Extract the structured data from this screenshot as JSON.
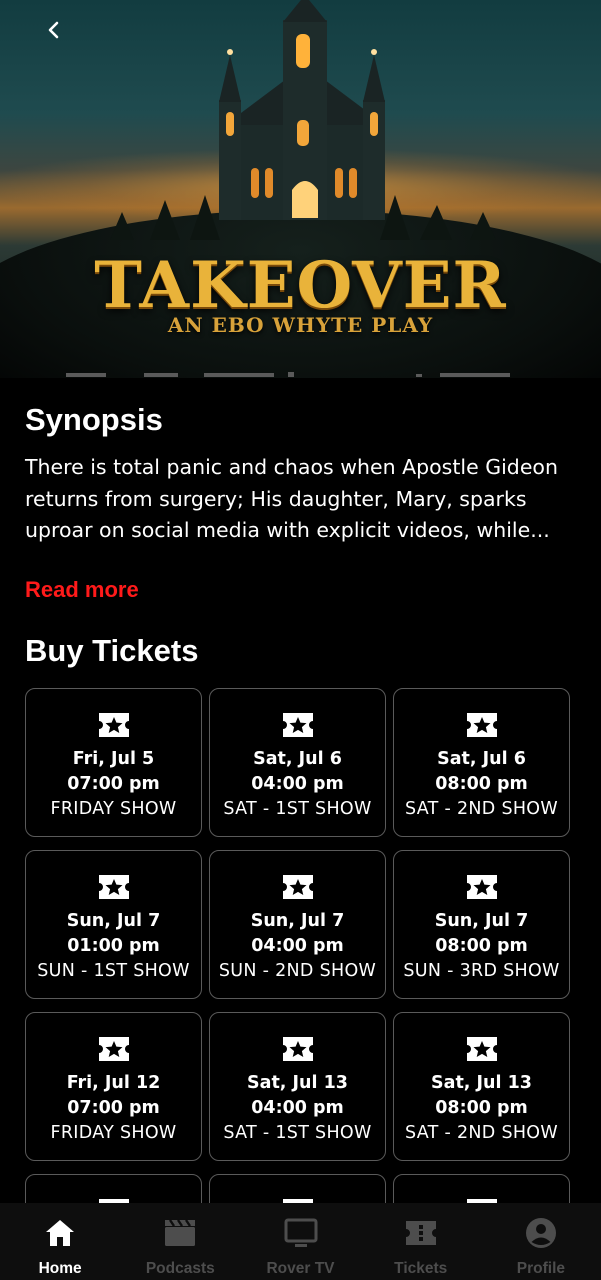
{
  "poster": {
    "title": "TAKEOVER",
    "subtitle": "AN EBO WHYTE PLAY"
  },
  "icons": {
    "back": "chevron-left-icon",
    "ticket": "ticket-star-icon"
  },
  "synopsis": {
    "heading": "Synopsis",
    "text": "There is total panic and chaos when Apostle Gideon returns from surgery; His daughter, Mary, sparks uproar on social media with explicit videos, while...",
    "read_more": "Read more"
  },
  "tickets": {
    "heading": "Buy Tickets",
    "items": [
      {
        "date": "Fri, Jul 5",
        "time": "07:00 pm",
        "name": "FRIDAY SHOW"
      },
      {
        "date": "Sat, Jul 6",
        "time": "04:00 pm",
        "name": "SAT - 1ST SHOW"
      },
      {
        "date": "Sat, Jul 6",
        "time": "08:00 pm",
        "name": "SAT - 2ND SHOW"
      },
      {
        "date": "Sun, Jul 7",
        "time": "01:00 pm",
        "name": "SUN - 1ST SHOW"
      },
      {
        "date": "Sun, Jul 7",
        "time": "04:00 pm",
        "name": "SUN - 2ND SHOW"
      },
      {
        "date": "Sun, Jul 7",
        "time": "08:00 pm",
        "name": "SUN - 3RD SHOW"
      },
      {
        "date": "Fri, Jul 12",
        "time": "07:00 pm",
        "name": "FRIDAY SHOW"
      },
      {
        "date": "Sat, Jul 13",
        "time": "04:00 pm",
        "name": "SAT - 1ST SHOW"
      },
      {
        "date": "Sat, Jul 13",
        "time": "08:00 pm",
        "name": "SAT - 2ND SHOW"
      }
    ]
  },
  "nav": {
    "items": [
      {
        "label": "Home",
        "icon": "home-icon",
        "active": true
      },
      {
        "label": "Podcasts",
        "icon": "clapperboard-icon",
        "active": false
      },
      {
        "label": "Rover TV",
        "icon": "tv-icon",
        "active": false
      },
      {
        "label": "Tickets",
        "icon": "ticket-icon",
        "active": false
      },
      {
        "label": "Profile",
        "icon": "profile-icon",
        "active": false
      }
    ]
  },
  "colors": {
    "background": "#000000",
    "accent_red": "#ff1a1a",
    "nav_inactive": "#4d4d4d",
    "card_border": "#5a5a5a",
    "poster_gold": "#e9b33a"
  }
}
